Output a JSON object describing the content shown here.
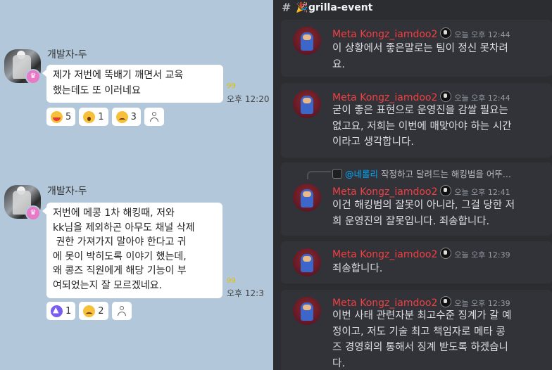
{
  "kakao": {
    "messages": [
      {
        "sender": "개발자-두",
        "lines": [
          "제가 저번에 뚝배기 깨면서 교육",
          "했는데도 또 이러네요"
        ],
        "unread": "99",
        "time": "오후 12:20",
        "reactions": [
          {
            "icon": "laugh-emoji-icon",
            "count": "5"
          },
          {
            "icon": "surprised-emoji-icon",
            "count": "1"
          },
          {
            "icon": "sad-emoji-icon",
            "count": "3"
          }
        ]
      },
      {
        "sender": "개발자-두",
        "lines": [
          "저번에 메콩 1차 해킹때, 저와",
          "kk님을 제외하곤 아무도 채널 삭제",
          " 권한 가져가지 말아야 한다고 귀",
          "에 못이 박히도록 이야기 했는데,",
          "왜 콩즈 직원에게 해당 기능이 부",
          "여되었는지 잘 모르겠네요."
        ],
        "unread": "99",
        "time": "오후 12:3",
        "reactions": [
          {
            "icon": "like-emoji-icon",
            "count": "1"
          },
          {
            "icon": "sad-emoji-icon",
            "count": "2"
          }
        ]
      }
    ]
  },
  "discord": {
    "channel": {
      "hash": "#",
      "emoji": "🎉",
      "name": "grilla-event"
    },
    "messages": [
      {
        "author": "Meta Kongz_iamdoo2",
        "time": "오늘 오후 12:44",
        "lines": [
          "이 상황에서 좋은말로는 팀이 정신 못차려",
          "요."
        ]
      },
      {
        "author": "Meta Kongz_iamdoo2",
        "time": "오늘 오후 12:44",
        "lines": [
          "굳이 좋은 표현으로 운영진을 감쌀 필요는",
          "없고요, 저희는 이번에 매맞아야 하는 시간",
          "이라고 생각합니다."
        ]
      },
      {
        "reply": {
          "mention": "@네롤리",
          "text": " 작정하고 달려드는 해킹범을 어뚜..."
        },
        "author": "Meta Kongz_iamdoo2",
        "time": "오늘 오후 12:41",
        "lines": [
          "이건 해킹범의 잘못이 아니라, 그걸 당한 저",
          "희 운영진의 잘못입니다. 죄송합니다."
        ]
      },
      {
        "author": "Meta Kongz_iamdoo2",
        "time": "오늘 오후 12:39",
        "lines": [
          "죄송합니다."
        ]
      },
      {
        "author": "Meta Kongz_iamdoo2",
        "time": "오늘 오후 12:39",
        "lines": [
          "이번 사태 관련자분 최고수준 징계가 갈 예",
          "정이고, 저도 기술 최고 책임자로 메타 콩",
          "즈 경영회의 통해서 징계 받도록 하겠습니",
          "다."
        ]
      }
    ]
  },
  "colors": {
    "kakao_bg": "#b2c7da",
    "discord_bg": "#2b2d31",
    "discord_card": "#313338",
    "discord_username": "#f23f43",
    "mention": "#00a8fc",
    "unread": "#e3c000"
  }
}
